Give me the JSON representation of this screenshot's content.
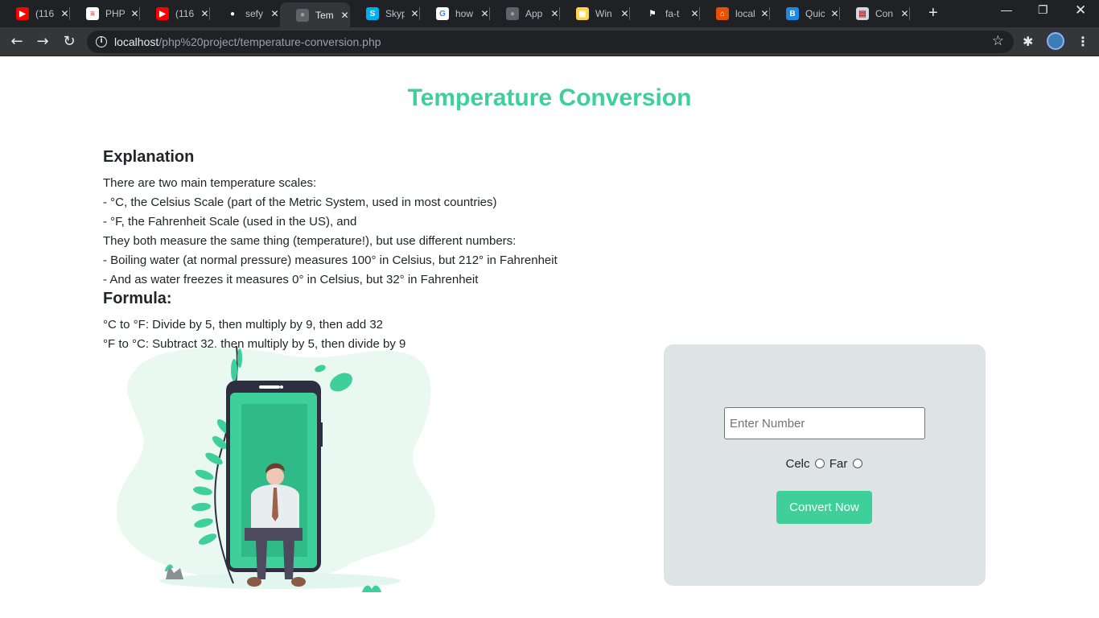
{
  "browser": {
    "tabs": [
      {
        "title": "(116",
        "icon": "youtube-icon",
        "color": "#ff0000"
      },
      {
        "title": "PHP",
        "icon": "php-doc-icon",
        "color": "#ffffff"
      },
      {
        "title": "(116",
        "icon": "youtube-icon",
        "color": "#ff0000"
      },
      {
        "title": "sefy",
        "icon": "github-icon",
        "color": "#202124"
      },
      {
        "title": "Tem",
        "icon": "globe-icon",
        "color": "#5f6368"
      },
      {
        "title": "Skyp",
        "icon": "skype-icon",
        "color": "#00aff0"
      },
      {
        "title": "how",
        "icon": "google-icon",
        "color": "#ffffff"
      },
      {
        "title": "App",
        "icon": "globe-icon",
        "color": "#5f6368"
      },
      {
        "title": "Win",
        "icon": "windows-icon",
        "color": "#ffd54f"
      },
      {
        "title": "fa-t",
        "icon": "flag-icon",
        "color": "#202124"
      },
      {
        "title": "local",
        "icon": "xampp-icon",
        "color": "#e65100"
      },
      {
        "title": "Quic",
        "icon": "bootstrap-icon",
        "color": "#1e88e5"
      },
      {
        "title": "Con",
        "icon": "document-icon",
        "color": "#cfd8dc"
      }
    ],
    "active_tab_index": 4,
    "url_host": "localhost",
    "url_path": "/php%20project/temperature-conversion.php"
  },
  "page": {
    "title": "Temperature Conversion",
    "explanation_heading": "Explanation",
    "explanation_lines": [
      "There are two main temperature scales:",
      "- °C, the Celsius Scale (part of the Metric System, used in most countries)",
      "- °F, the Fahrenheit Scale (used in the US), and",
      "They both measure the same thing (temperature!), but use different numbers:",
      "- Boiling water (at normal pressure) measures 100° in Celsius, but 212° in Fahrenheit",
      "- And as water freezes it measures 0° in Celsius, but 32° in Fahrenheit"
    ],
    "formula_heading": "Formula:",
    "formula_lines": [
      "°C to °F: Divide by 5, then multiply by 9, then add 32",
      "°F to °C: Subtract 32, then multiply by 5, then divide by 9"
    ]
  },
  "form": {
    "input_placeholder": "Enter Number",
    "input_value": "",
    "radio_celsius_label": "Celc",
    "radio_fahrenheit_label": "Far",
    "convert_button": "Convert Now"
  },
  "colors": {
    "accent": "#3ecf9a",
    "card_bg": "#dee3e6"
  }
}
